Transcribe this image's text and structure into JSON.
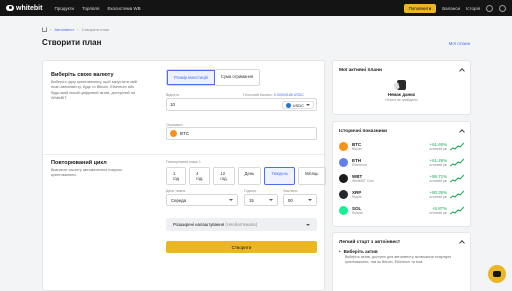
{
  "topbar": {
    "brand": "whitebit",
    "nav": [
      "Продукти",
      "Торгівля",
      "Екосистема WB"
    ],
    "cta": "Поповнити",
    "links": [
      "Баланси",
      "Історія"
    ]
  },
  "breadcrumb": {
    "link": "Автоінвест",
    "current": "Створити план"
  },
  "title": "Створити план",
  "my_plans": "Мої плани",
  "section1": {
    "title": "Виберіть свою валюту",
    "desc": "Виберіть одну криптовалюту, щоб запустити свій план автоінвесту, будь то Bitcoin, Ethereum або будь-який інший цифровий актив, доступний на WhiteBIT.",
    "mode_options": [
      "Розмір інвестицій",
      "Сума отримання"
    ],
    "amount_label": "Відняти",
    "min_hint_prefix": "Поточний баланс:",
    "min_hint_value": "0.00000185 USDC",
    "amount_value": "10",
    "pay_currency": "USDC",
    "receive_label": "Отримати",
    "receive_currency": "BTC"
  },
  "section2": {
    "title": "Повторюваний цикл",
    "desc": "Визначте частоту автоматичних покупок криптовалюти.",
    "period_label": "Повторювати кожні 1",
    "periods": [
      "1 год",
      "4 год.",
      "12 год.",
      "День",
      "Тиждень",
      "Місяць"
    ],
    "active_period": "Тиждень",
    "day_label": "День тижня",
    "day_value": "Середа",
    "hours_label": "Години",
    "hours_value": "15",
    "minutes_label": "Хвилини",
    "minutes_value": "00"
  },
  "advanced": {
    "label": "Розширені налаштування",
    "optional": "(Необов'язково)"
  },
  "create_button": "Створити",
  "active_plans": {
    "title": "Мої активні плани",
    "empty_title": "Немає даних",
    "empty_sub": "Нічого не знайдено"
  },
  "history": {
    "title": "Історичні показники",
    "coins": [
      {
        "symbol": "BTC",
        "name": "Bitcoin",
        "pct": "+61.65%",
        "period": "останній рік",
        "color": "#f7931a"
      },
      {
        "symbol": "ETH",
        "name": "Ethereum",
        "pct": "+61.26%",
        "period": "останній рік",
        "color": "#627eea"
      },
      {
        "symbol": "WBT",
        "name": "WhiteBIT Coin",
        "pct": "+95.71%",
        "period": "останній рік",
        "color": "#1b1b1b"
      },
      {
        "symbol": "XRP",
        "name": "Ripple",
        "pct": "+80.35%",
        "period": "останній рік",
        "color": "#23292f"
      },
      {
        "symbol": "SOL",
        "name": "Solana",
        "pct": "+5.87%",
        "period": "останній рік",
        "color": "#14f195"
      }
    ]
  },
  "easy_start": {
    "title": "Легкий старт з автоінвест",
    "item_title": "Виберіть актив",
    "item_text": "Виберіть актив, доступні для автоінвесту, включаючи популярні криптовалюти, такі як Bitcoin, Ethereum та інші."
  }
}
